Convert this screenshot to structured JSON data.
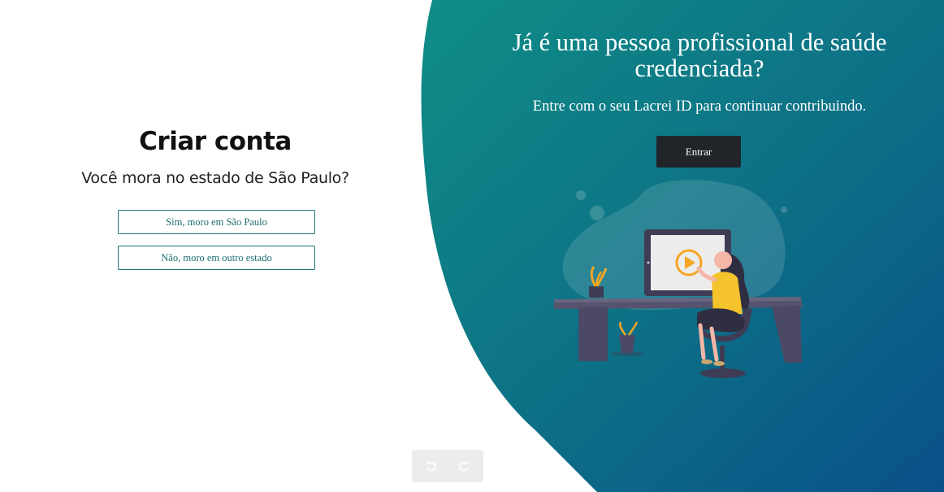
{
  "signup": {
    "title": "Criar conta",
    "question": "Você mora no estado de São Paulo?",
    "option_yes": "Sim, moro em São Paulo",
    "option_no": "Não, moro em outro estado"
  },
  "login_panel": {
    "headline_line1": "Já é uma pessoa profissional de saúde",
    "headline_line2": "credenciada?",
    "subtitle": "Entre com o seu Lacrei ID para continuar contribuindo.",
    "login_button": "Entrar"
  },
  "history_controls": {
    "undo_icon": "undo-icon",
    "redo_icon": "redo-icon"
  },
  "colors": {
    "teal": "#1d8a86",
    "navy": "#0a4d86",
    "button_dark": "#212428",
    "outline": "#1d6e72"
  }
}
